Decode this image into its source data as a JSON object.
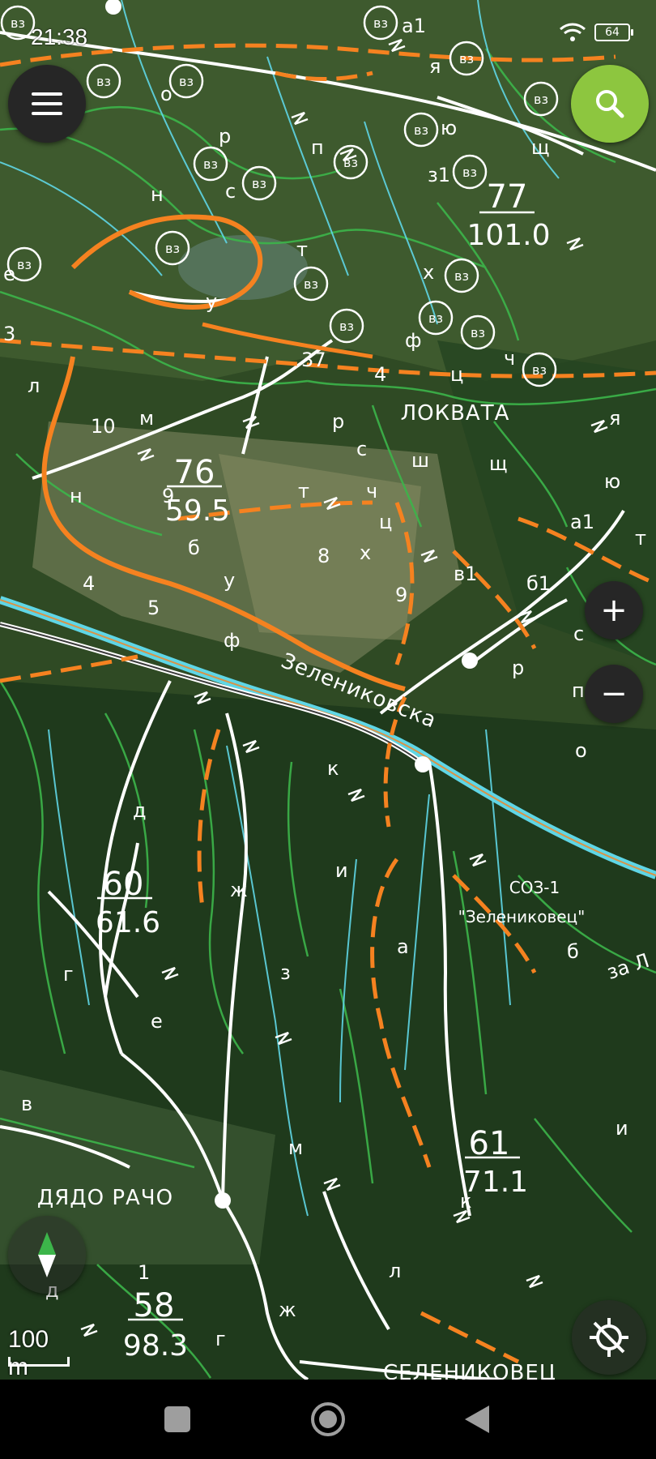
{
  "status_bar": {
    "time": "21:38",
    "battery": "64"
  },
  "controls": {
    "menu_icon": "hamburger-menu-icon",
    "search_icon": "search-icon",
    "zoom_in_label": "+",
    "zoom_out_label": "−",
    "gps_icon": "location-off-icon",
    "compass_icon": "compass-icon"
  },
  "scale_bar": {
    "label": "100 m"
  },
  "colors": {
    "accent_green": "#8dc63f",
    "boundary_orange": "#f58220",
    "stream_cyan": "#5fd6e6",
    "parcel_green": "#3cb54a"
  },
  "map": {
    "locality_labels": [
      "ЛОКВАТА",
      "Зелениковска",
      "ДЯДО РАЧО",
      "СЕЛЕНИКОВЕЦ",
      "СОЗ-1",
      "\"Зелениковец\"",
      "за Л"
    ],
    "forest_sections": [
      {
        "number": "77",
        "area": "101.0"
      },
      {
        "number": "76",
        "area": "59.5"
      },
      {
        "number": "60",
        "area": "61.6"
      },
      {
        "number": "61",
        "area": "71.1"
      },
      {
        "number": "58",
        "area": "98.3"
      }
    ],
    "protected_marker_label": "вз",
    "subsection_labels": [
      "а1",
      "я",
      "ю",
      "щ",
      "з1",
      "о",
      "р",
      "п",
      "с",
      "н",
      "е",
      "т",
      "х",
      "у",
      "ф",
      "3",
      "4",
      "ц",
      "ч",
      "л",
      "10",
      "м",
      "37",
      "р",
      "с",
      "ш",
      "щ",
      "ю",
      "я",
      "н",
      "9",
      "т",
      "ч",
      "ц",
      "а1",
      "т",
      "б",
      "8",
      "х",
      "в1",
      "б1",
      "4",
      "5",
      "у",
      "ф",
      "9",
      "с",
      "р",
      "п",
      "о",
      "к",
      "д",
      "и",
      "ж",
      "з",
      "а",
      "б",
      "г",
      "е",
      "в",
      "м",
      "к",
      "л",
      "и",
      "1",
      "д",
      "г",
      "ж"
    ]
  }
}
